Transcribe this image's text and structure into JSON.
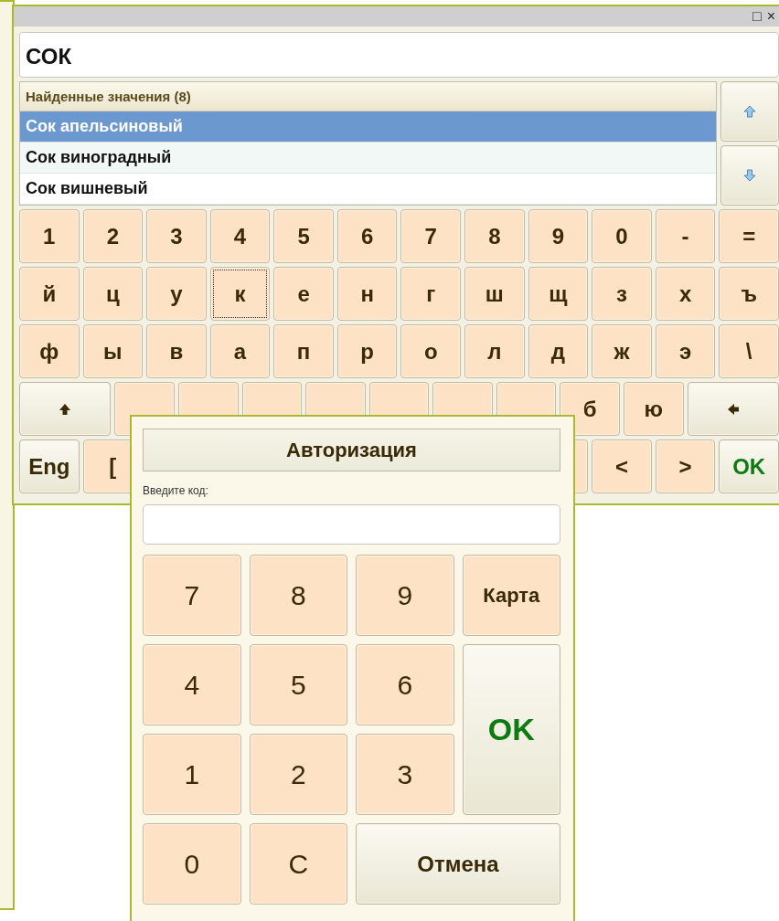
{
  "window": {
    "controls": [
      "□",
      "×"
    ]
  },
  "search": {
    "value": "СОК"
  },
  "results": {
    "header": "Найденные значения (8)",
    "items": [
      {
        "label": "Сок апельсиновый",
        "selected": true
      },
      {
        "label": "Сок виноградный",
        "selected": false
      },
      {
        "label": "Сок вишневый",
        "selected": false
      }
    ]
  },
  "keyboard": {
    "rows": [
      [
        {
          "kind": "char",
          "label": "1",
          "focused": false
        },
        {
          "kind": "char",
          "label": "2",
          "focused": false
        },
        {
          "kind": "char",
          "label": "3",
          "focused": false
        },
        {
          "kind": "char",
          "label": "4",
          "focused": false
        },
        {
          "kind": "char",
          "label": "5",
          "focused": false
        },
        {
          "kind": "char",
          "label": "6",
          "focused": false
        },
        {
          "kind": "char",
          "label": "7",
          "focused": false
        },
        {
          "kind": "char",
          "label": "8",
          "focused": false
        },
        {
          "kind": "char",
          "label": "9",
          "focused": false
        },
        {
          "kind": "char",
          "label": "0",
          "focused": false
        },
        {
          "kind": "char",
          "label": "-",
          "focused": false
        },
        {
          "kind": "char",
          "label": "=",
          "focused": false
        }
      ],
      [
        {
          "kind": "char",
          "label": "й",
          "focused": false
        },
        {
          "kind": "char",
          "label": "ц",
          "focused": false
        },
        {
          "kind": "char",
          "label": "у",
          "focused": false
        },
        {
          "kind": "char",
          "label": "к",
          "focused": true
        },
        {
          "kind": "char",
          "label": "е",
          "focused": false
        },
        {
          "kind": "char",
          "label": "н",
          "focused": false
        },
        {
          "kind": "char",
          "label": "г",
          "focused": false
        },
        {
          "kind": "char",
          "label": "ш",
          "focused": false
        },
        {
          "kind": "char",
          "label": "щ",
          "focused": false
        },
        {
          "kind": "char",
          "label": "з",
          "focused": false
        },
        {
          "kind": "char",
          "label": "х",
          "focused": false
        },
        {
          "kind": "char",
          "label": "ъ",
          "focused": false
        }
      ],
      [
        {
          "kind": "char",
          "label": "ф",
          "focused": false
        },
        {
          "kind": "char",
          "label": "ы",
          "focused": false
        },
        {
          "kind": "char",
          "label": "в",
          "focused": false
        },
        {
          "kind": "char",
          "label": "а",
          "focused": false
        },
        {
          "kind": "char",
          "label": "п",
          "focused": false
        },
        {
          "kind": "char",
          "label": "р",
          "focused": false
        },
        {
          "kind": "char",
          "label": "о",
          "focused": false
        },
        {
          "kind": "char",
          "label": "л",
          "focused": false
        },
        {
          "kind": "char",
          "label": "д",
          "focused": false
        },
        {
          "kind": "char",
          "label": "ж",
          "focused": false
        },
        {
          "kind": "char",
          "label": "э",
          "focused": false
        },
        {
          "kind": "char",
          "label": "\\",
          "focused": false
        }
      ],
      [
        {
          "kind": "shift",
          "focused": false
        },
        {
          "kind": "covered"
        },
        {
          "kind": "covered"
        },
        {
          "kind": "covered"
        },
        {
          "kind": "covered"
        },
        {
          "kind": "covered"
        },
        {
          "kind": "covered"
        },
        {
          "kind": "covered"
        },
        {
          "kind": "char",
          "label": "б",
          "focused": false
        },
        {
          "kind": "char",
          "label": "ю",
          "focused": false
        },
        {
          "kind": "backspace",
          "focused": false
        }
      ],
      [
        {
          "kind": "special",
          "label": "Eng",
          "focused": false
        },
        {
          "kind": "char",
          "label": "[",
          "focused": false
        },
        "",
        "",
        "",
        "",
        "",
        "",
        {
          "kind": "covered"
        },
        {
          "kind": "char",
          "label": "<",
          "focused": false
        },
        {
          "kind": "char",
          "label": ">",
          "focused": false
        },
        {
          "kind": "confirm",
          "label": "OK",
          "focused": false
        }
      ]
    ]
  },
  "dialog": {
    "title": "Авторизация",
    "code_label": "Введите код:",
    "keys": [
      {
        "kind": "digit",
        "label": "7"
      },
      {
        "kind": "digit",
        "label": "8"
      },
      {
        "kind": "digit",
        "label": "9"
      },
      {
        "kind": "digit",
        "label": "Карта"
      },
      {
        "kind": "digit",
        "label": "4"
      },
      {
        "kind": "digit",
        "label": "5"
      },
      {
        "kind": "digit",
        "label": "6"
      },
      {
        "kind": "confirm",
        "label": "OK"
      },
      {
        "kind": "digit",
        "label": "1"
      },
      {
        "kind": "digit",
        "label": "2"
      },
      {
        "kind": "digit",
        "label": "3"
      },
      {
        "kind": "digit",
        "label": "0"
      },
      {
        "kind": "digit",
        "label": "C"
      },
      {
        "kind": "cancel",
        "label": "Отмена"
      }
    ]
  }
}
